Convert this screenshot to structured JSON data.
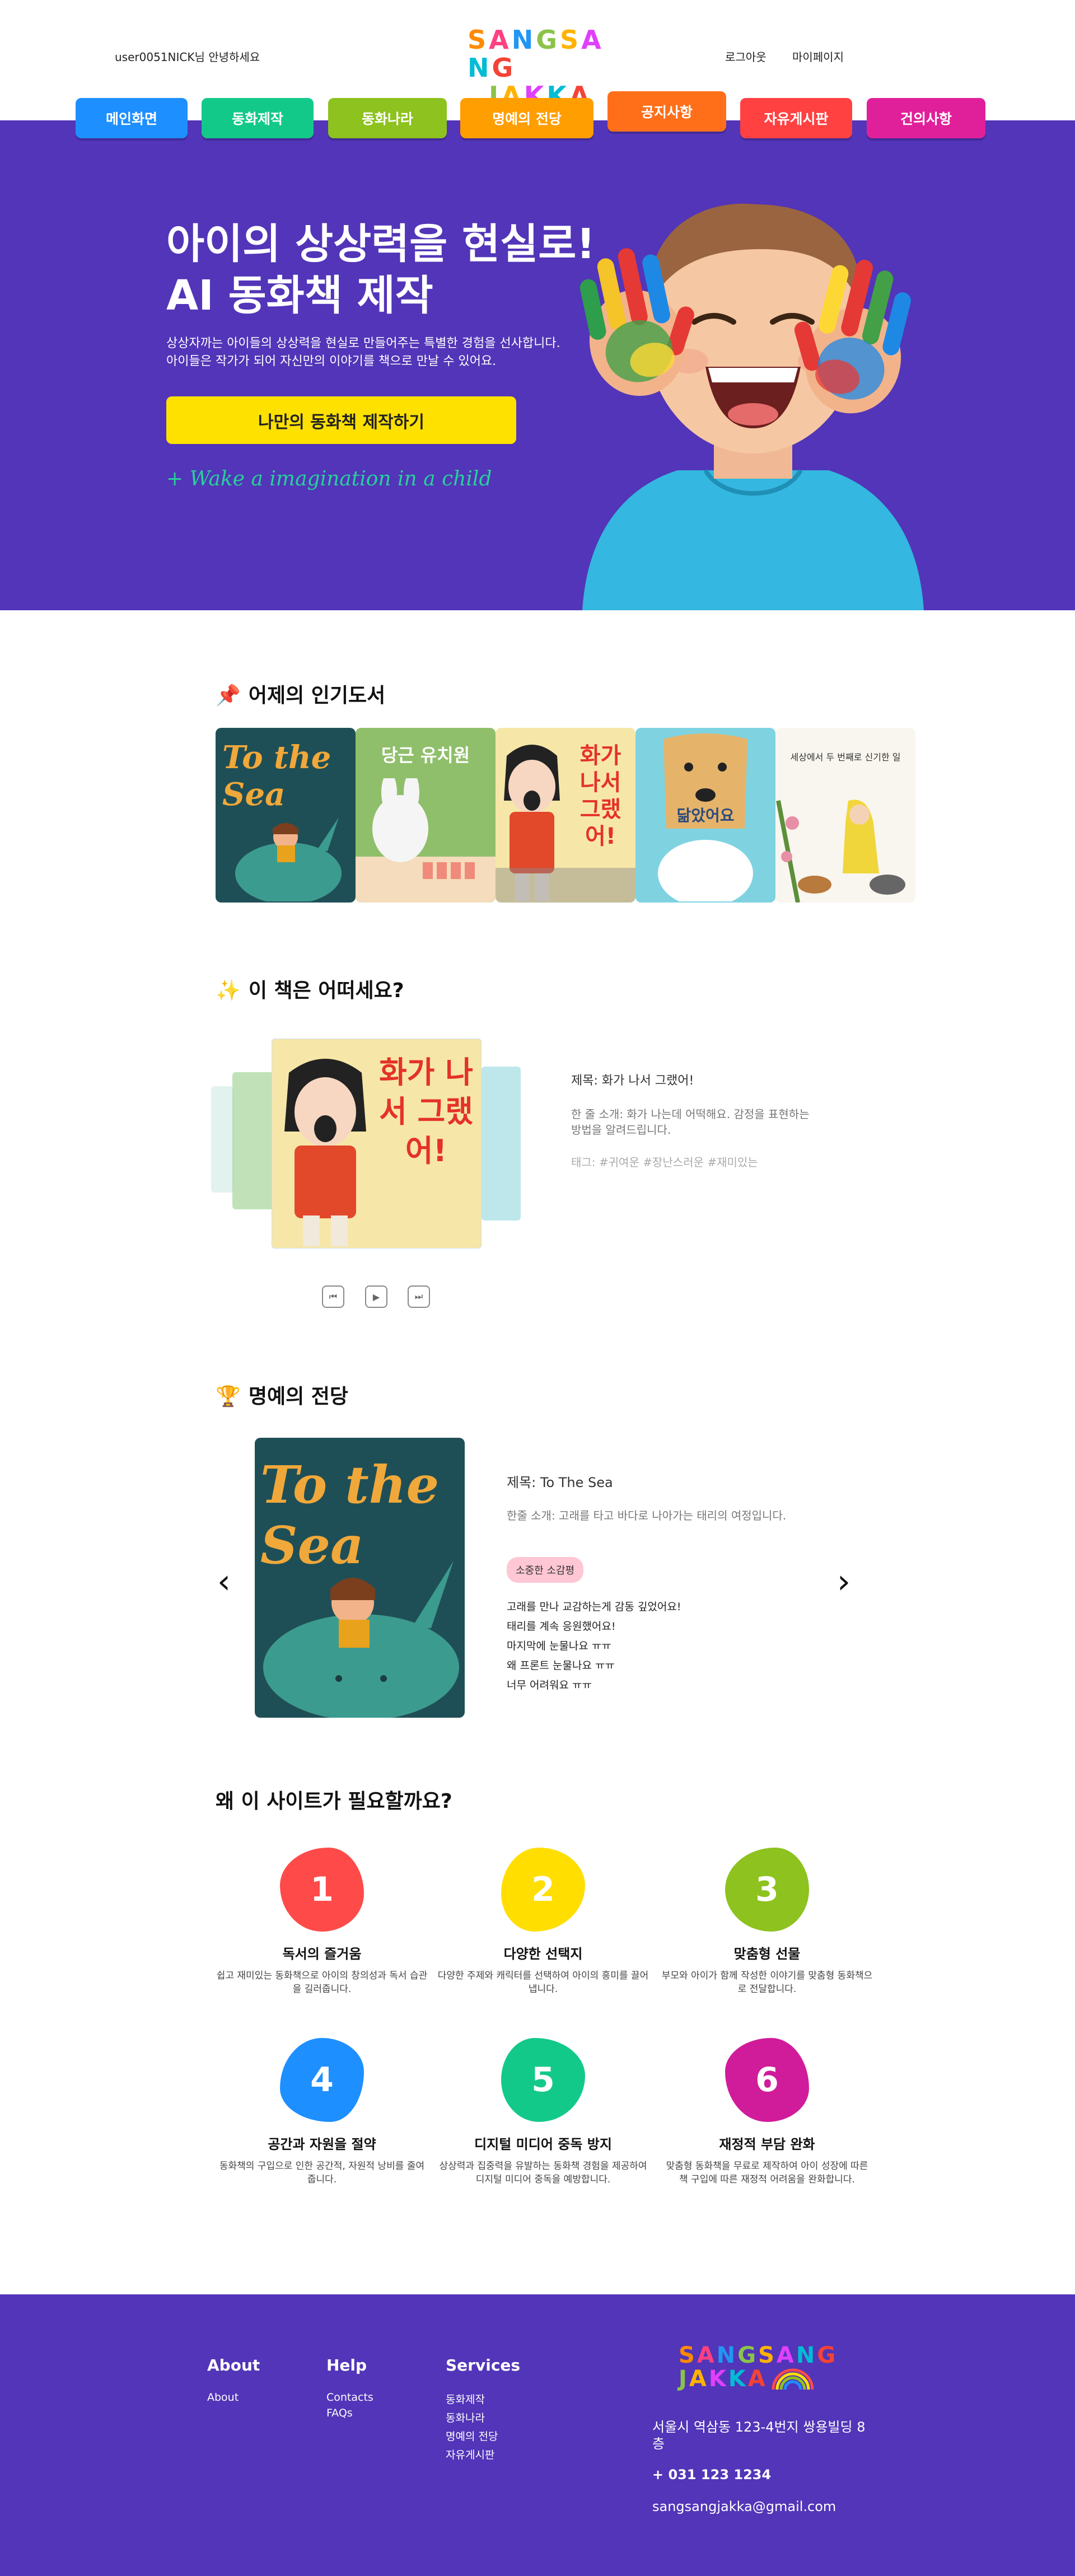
{
  "header": {
    "greeting": "user0051NICK님 안녕하세요",
    "logo_line1": "SANGSANG",
    "logo_line2": "JAKKA",
    "logo_colors": [
      "#ff8a00",
      "#ff4081",
      "#2196f3",
      "#8bc34a",
      "#ffb300",
      "#e040fb",
      "#00bcd4",
      "#f44336"
    ],
    "links": [
      "로그아웃",
      "마이페이지"
    ]
  },
  "nav": [
    {
      "label": "메인화면",
      "color": "#1e8fff"
    },
    {
      "label": "동화제작",
      "color": "#13c98a"
    },
    {
      "label": "동화나라",
      "color": "#8dc21f"
    },
    {
      "label": "명예의 전당",
      "color": "#ff9e00"
    },
    {
      "label": "공지사항",
      "color": "#ff6f1a"
    },
    {
      "label": "자유게시판",
      "color": "#ff4141"
    },
    {
      "label": "건의사항",
      "color": "#e0209a"
    }
  ],
  "hero": {
    "title_line1": "아이의 상상력을 현실로!",
    "title_line2": "AI 동화책 제작",
    "desc_line1": "상상자까는 아이들의 상상력을 현실로 만들어주는 특별한 경험을 선사합니다.",
    "desc_line2": "아이들은 작가가 되어 자신만의 이야기를 책으로 만날 수 있어요.",
    "cta": "나만의 동화책 제작하기",
    "slogan": "+ Wake a imagination in a child",
    "bg": "#5235b8"
  },
  "popular": {
    "title": "어제의 인기도서",
    "books": [
      {
        "title": "To the Sea",
        "bg": "#1f4f56"
      },
      {
        "title": "당근 유치원",
        "bg": "#8fbf6a"
      },
      {
        "title": "화가 나서 그랬어!",
        "bg": "#f6e7a8"
      },
      {
        "title": "닮았어요",
        "bg": "#7fd3e0"
      },
      {
        "title": "세상에서 두 번째로 신기한 일",
        "bg": "#f8f6ee"
      }
    ]
  },
  "recommend": {
    "title": "이 책은 어떠세요?",
    "book_title": "화가 나서 그랬어!",
    "info_title": "제목: 화가 나서 그랬어!",
    "info_summary": "한 줄 소개: 화가 나는데 어떡해요. 감정을 표현하는 방법을 알려드립니다.",
    "info_tags": "태그: #귀여운 #장난스러운 #재미있는",
    "controls": [
      "⏮",
      "▶",
      "⏭"
    ]
  },
  "hall": {
    "title": "명예의 전당",
    "book_title": "To the Sea",
    "info_title": "제목: To The Sea",
    "info_summary": "한줄 소개: 고래를 타고 바다로 나아가는 태리의 여정입니다.",
    "badge": "소중한 소감평",
    "comments": [
      "고래를 만나 교감하는게 감동 깊었어요!",
      "태리를 계속 응원했어요!",
      "마지막에 눈물나요 ㅠㅠ",
      "왜 프론트 눈물나요 ㅠㅠ",
      "너무 어려워요 ㅠㅠ"
    ],
    "prev": "‹",
    "next": "›"
  },
  "why": {
    "title": "왜 이 사이트가 필요할까요?",
    "items": [
      {
        "num": "1",
        "color": "#ff4a4a",
        "title": "독서의 즐거움",
        "desc": "쉽고 재미있는 동화책으로 아이의 창의성과 독서 습관을 길러줍니다."
      },
      {
        "num": "2",
        "color": "#ffde00",
        "title": "다양한 선택지",
        "desc": "다양한 주제와 캐릭터를 선택하여 아이의 흥미를 끌어냅니다."
      },
      {
        "num": "3",
        "color": "#8dc21f",
        "title": "맞춤형 선물",
        "desc": "부모와 아이가 함께 작성한 이야기를 맞춤형 동화책으로 전달합니다."
      },
      {
        "num": "4",
        "color": "#1e8fff",
        "title": "공간과 자원을 절약",
        "desc": "동화책의 구입으로 인한 공간적, 자원적 낭비를 줄여줍니다."
      },
      {
        "num": "5",
        "color": "#13c98a",
        "title": "디지털 미디어 중독 방지",
        "desc": "상상력과 집중력을 유발하는 동화책 경험을 제공하여 디지털 미디어 중독을 예방합니다."
      },
      {
        "num": "6",
        "color": "#d01c9a",
        "title": "재정적 부담 완화",
        "desc": "맞춤형 동화책을 무료로 제작하여 아이 성장에 따른 책 구입에 따른 재정적 어려움을 완화합니다."
      }
    ]
  },
  "footer": {
    "about_title": "About",
    "about_links": [
      "About"
    ],
    "help_title": "Help",
    "help_links": [
      "Contacts",
      "FAQs"
    ],
    "services_title": "Services",
    "services_links": [
      "동화제작",
      "동화나라",
      "명예의 전당",
      "자유게시판"
    ],
    "logo_line1": "SANGSANG",
    "logo_line2": "JAKKA",
    "address": "서울시 역삼동 123-4번지 쌍용빌딩 8층",
    "phone": "+ 031 123 1234",
    "email": "sangsangjakka@gmail.com"
  }
}
